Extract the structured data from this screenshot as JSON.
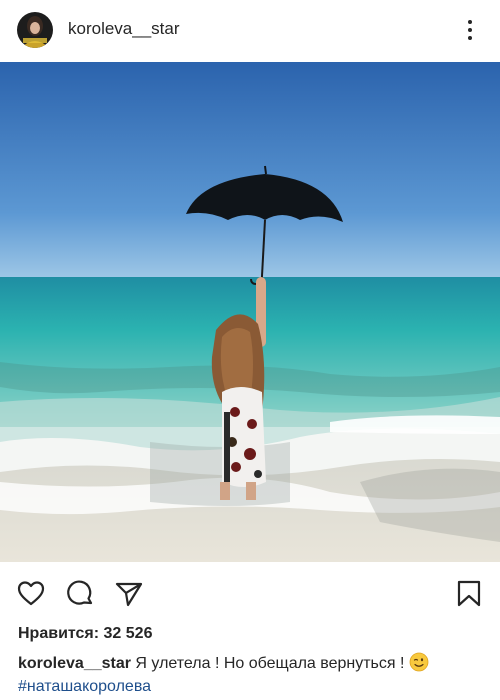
{
  "post": {
    "username": "koroleva__star",
    "likes_label": "Нравится: 32 526",
    "caption_user": "koroleva__star",
    "caption_text": " Я улетела ! Но обещала вернуться !",
    "caption_emoji": "winking-face-emoji",
    "hashtag": "#наташакоролева"
  },
  "icons": {
    "more": "more-vertical-icon",
    "like": "heart-outline-icon",
    "comment": "comment-bubble-icon",
    "share": "paper-plane-icon",
    "save": "bookmark-icon"
  },
  "colors": {
    "text": "#262626",
    "hashtag": "#1f4f8c",
    "sky_top": "#2d66b0",
    "sky_bottom": "#8fbde0",
    "sea": "#2bb0b0"
  }
}
